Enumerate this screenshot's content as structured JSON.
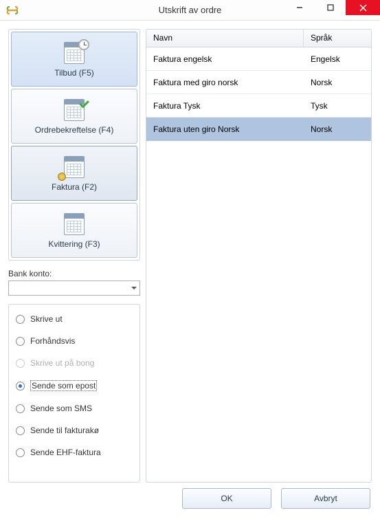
{
  "window": {
    "title": "Utskrift av ordre"
  },
  "big_buttons": [
    {
      "label": "Tilbud (F5)"
    },
    {
      "label": "Ordrebekreftelse (F4)"
    },
    {
      "label": "Faktura (F2)"
    },
    {
      "label": "Kvittering (F3)"
    }
  ],
  "bank_konto_label": "Bank konto:",
  "bank_konto_value": "",
  "output_options": [
    {
      "label": "Skrive ut",
      "checked": false,
      "disabled": false
    },
    {
      "label": "Forhåndsvis",
      "checked": false,
      "disabled": false
    },
    {
      "label": "Skrive ut på bong",
      "checked": false,
      "disabled": true
    },
    {
      "label": "Sende som epost",
      "checked": true,
      "disabled": false
    },
    {
      "label": "Sende som SMS",
      "checked": false,
      "disabled": false
    },
    {
      "label": "Sende til fakturakø",
      "checked": false,
      "disabled": false
    },
    {
      "label": "Sende EHF-faktura",
      "checked": false,
      "disabled": false
    }
  ],
  "grid": {
    "headers": {
      "navn": "Navn",
      "sprak": "Språk"
    },
    "rows": [
      {
        "navn": "Faktura engelsk",
        "sprak": "Engelsk",
        "selected": false
      },
      {
        "navn": "Faktura med giro norsk",
        "sprak": "Norsk",
        "selected": false
      },
      {
        "navn": "Faktura Tysk",
        "sprak": "Tysk",
        "selected": false
      },
      {
        "navn": "Faktura uten giro Norsk",
        "sprak": "Norsk",
        "selected": true
      }
    ]
  },
  "buttons": {
    "ok": "OK",
    "cancel": "Avbryt"
  }
}
